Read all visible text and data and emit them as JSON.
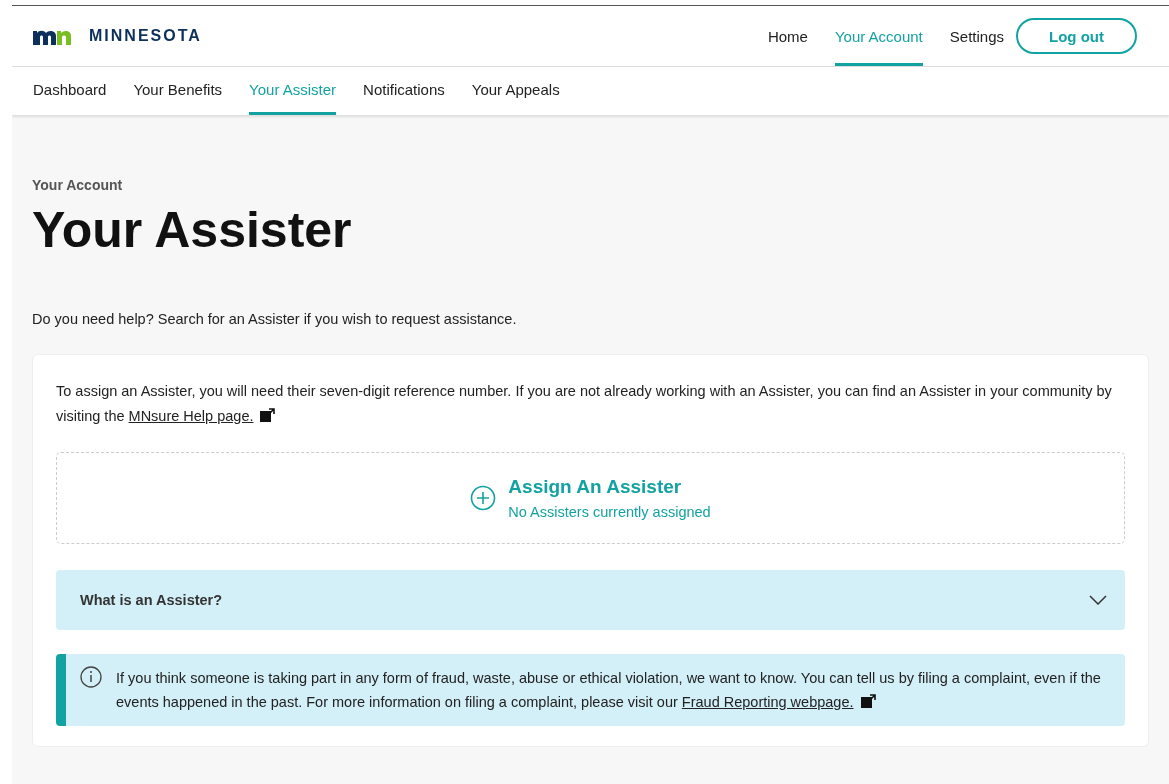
{
  "header": {
    "logo_text": "MINNESOTA",
    "nav": [
      {
        "label": "Home",
        "selected": false
      },
      {
        "label": "Your Account",
        "selected": true
      },
      {
        "label": "Settings",
        "selected": false
      }
    ],
    "logout": "Log out"
  },
  "tabs": [
    {
      "label": "Dashboard",
      "selected": false
    },
    {
      "label": "Your Benefits",
      "selected": false
    },
    {
      "label": "Your Assister",
      "selected": true
    },
    {
      "label": "Notifications",
      "selected": false
    },
    {
      "label": "Your Appeals",
      "selected": false
    }
  ],
  "breadcrumb": "Your Account",
  "title": "Your Assister",
  "intro": "Do you need help? Search for an Assister if you wish to request assistance.",
  "card": {
    "text": "To assign an Assister, you will need their seven-digit reference number. If you are not already working with an Assister, you can find an Assister in your community by visiting the ",
    "link": "MNsure Help page.",
    "assign": {
      "title": "Assign An Assister",
      "subtitle": "No Assisters currently assigned"
    },
    "accordion": {
      "title": "What is an Assister?",
      "expanded": false
    },
    "alert": {
      "text": "If you think someone is taking part in any form of fraud, waste, abuse or ethical violation, we want to know. You can tell us by filing a complaint, even if the events happened in the past. For more information on filing a complaint, please visit our ",
      "link": "Fraud Reporting webpage."
    }
  }
}
